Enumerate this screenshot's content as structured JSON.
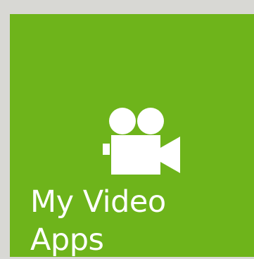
{
  "tile": {
    "label_line1": "My Video",
    "label_line2": "Apps",
    "icon": "video-camera-icon",
    "background_color": "#6eb41b",
    "text_color": "#ffffff"
  }
}
